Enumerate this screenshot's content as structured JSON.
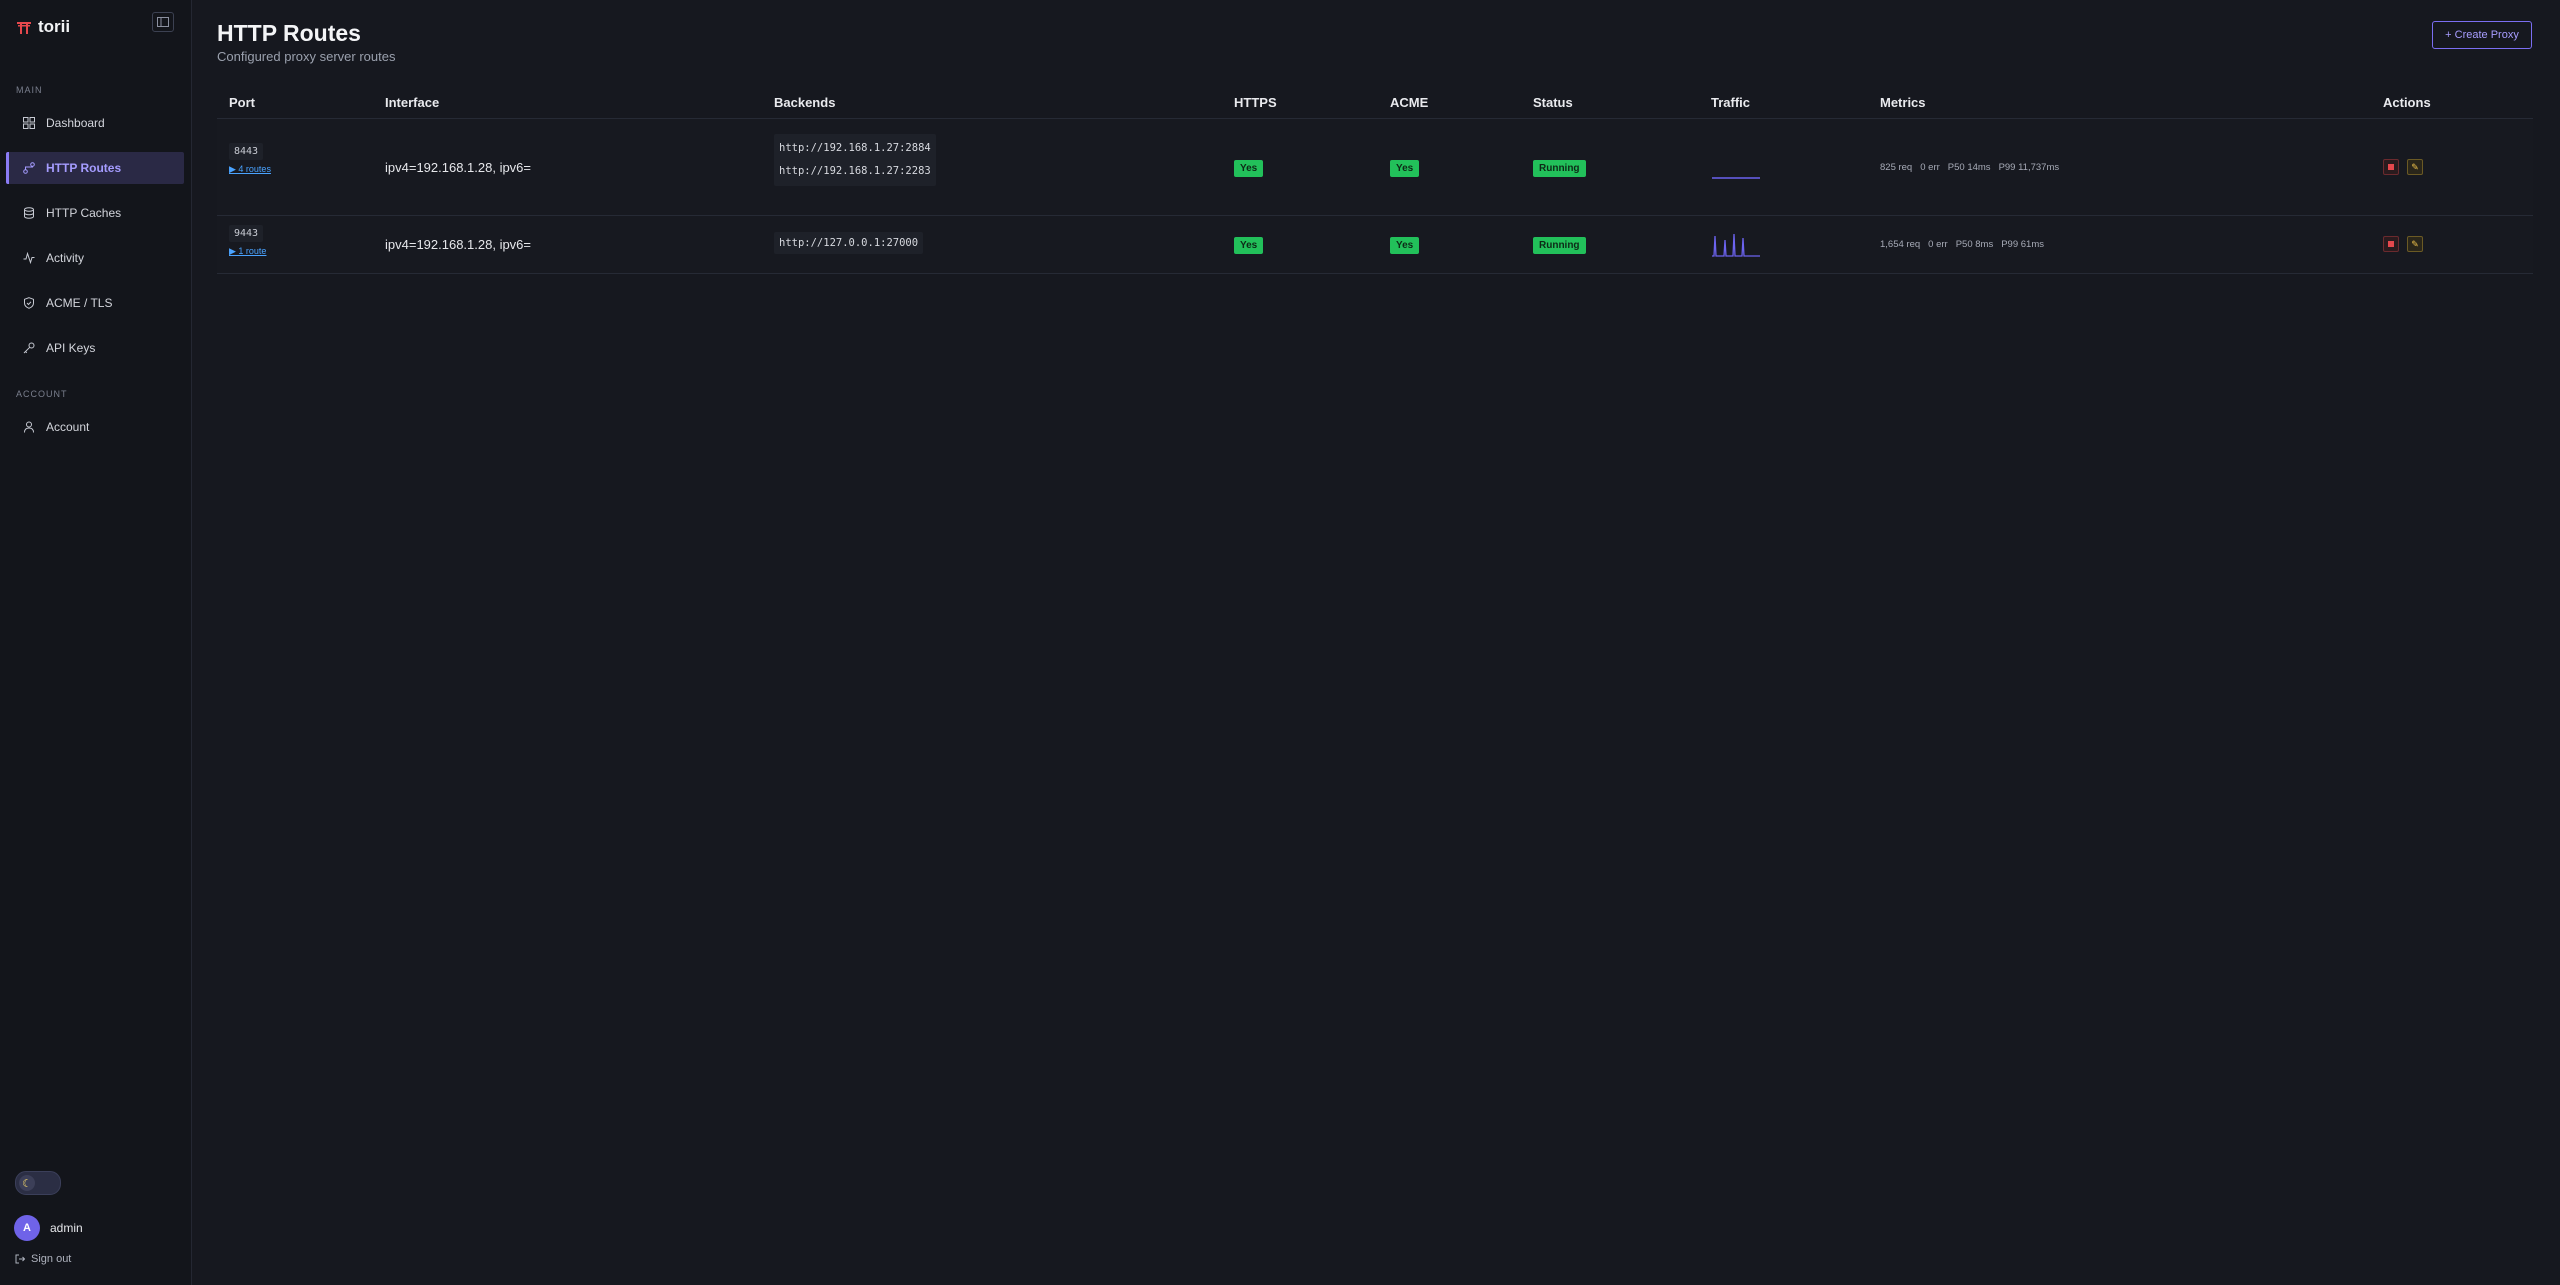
{
  "brand": {
    "name": "torii"
  },
  "sidebar": {
    "main_label": "MAIN",
    "account_label": "ACCOUNT",
    "items": [
      {
        "label": "Dashboard",
        "icon": "grid-icon"
      },
      {
        "label": "HTTP Routes",
        "icon": "routes-icon",
        "active": true
      },
      {
        "label": "HTTP Caches",
        "icon": "database-icon"
      },
      {
        "label": "Activity",
        "icon": "activity-icon"
      },
      {
        "label": "ACME / TLS",
        "icon": "shield-icon"
      },
      {
        "label": "API Keys",
        "icon": "key-icon"
      }
    ],
    "account_items": [
      {
        "label": "Account",
        "icon": "user-icon"
      }
    ],
    "theme": "dark",
    "user": {
      "initial": "A",
      "name": "admin"
    },
    "signout_label": "Sign out"
  },
  "page": {
    "title": "HTTP Routes",
    "subtitle": "Configured proxy server routes",
    "create_label": "+ Create Proxy"
  },
  "table": {
    "headers": {
      "port": "Port",
      "interface": "Interface",
      "backends": "Backends",
      "https": "HTTPS",
      "acme": "ACME",
      "status": "Status",
      "traffic": "Traffic",
      "metrics": "Metrics",
      "actions": "Actions"
    },
    "rows": [
      {
        "port": "8443",
        "routes_link": "▶ 4 routes",
        "interface": "ipv4=192.168.1.28, ipv6=",
        "backends": [
          "http://192.168.1.27:2884",
          "http://192.168.1.27:2283"
        ],
        "https": "Yes",
        "acme": "Yes",
        "status": "Running",
        "metrics": {
          "req": "825 req",
          "err": "0 err",
          "p50": "P50 14ms",
          "p99": "P99 11,737ms"
        }
      },
      {
        "port": "9443",
        "routes_link": "▶ 1 route",
        "interface": "ipv4=192.168.1.28, ipv6=",
        "backends": [
          "http://127.0.0.1:27000"
        ],
        "https": "Yes",
        "acme": "Yes",
        "status": "Running",
        "metrics": {
          "req": "1,654 req",
          "err": "0 err",
          "p50": "P50 8ms",
          "p99": "P99 61ms"
        }
      }
    ]
  },
  "colors": {
    "accent": "#8b7cf6",
    "success": "#22c05a",
    "danger": "#e5484d",
    "warning": "#f0c24b",
    "link": "#4aa3ff"
  }
}
